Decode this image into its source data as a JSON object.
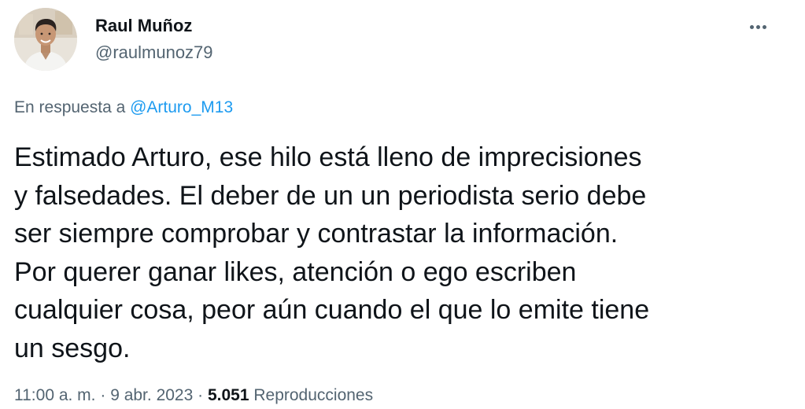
{
  "author": {
    "name": "Raul Muñoz",
    "handle": "@raulmunoz79",
    "avatar_icon": "profile-photo"
  },
  "more_options_icon": "more-horizontal-icon",
  "reply_context": {
    "prefix": "En respuesta a ",
    "mention": "@Arturo_M13"
  },
  "tweet": {
    "lines": [
      "Estimado Arturo, ese hilo está lleno de imprecisiones",
      "y falsedades. El deber de un un periodista serio debe",
      "ser siempre comprobar y contrastar la información.",
      "Por querer ganar likes, atención o ego escriben",
      "cualquier cosa, peor aún cuando el que lo emite tiene",
      "un sesgo."
    ]
  },
  "meta": {
    "time": "11:00 a. m.",
    "separator1": " · ",
    "date": "9 abr. 2023",
    "separator2": " · ",
    "views_count": "5.051",
    "views_label": " Reproducciones"
  },
  "colors": {
    "primary_text": "#0f1419",
    "secondary_text": "#536471",
    "link": "#1d9bf0"
  }
}
